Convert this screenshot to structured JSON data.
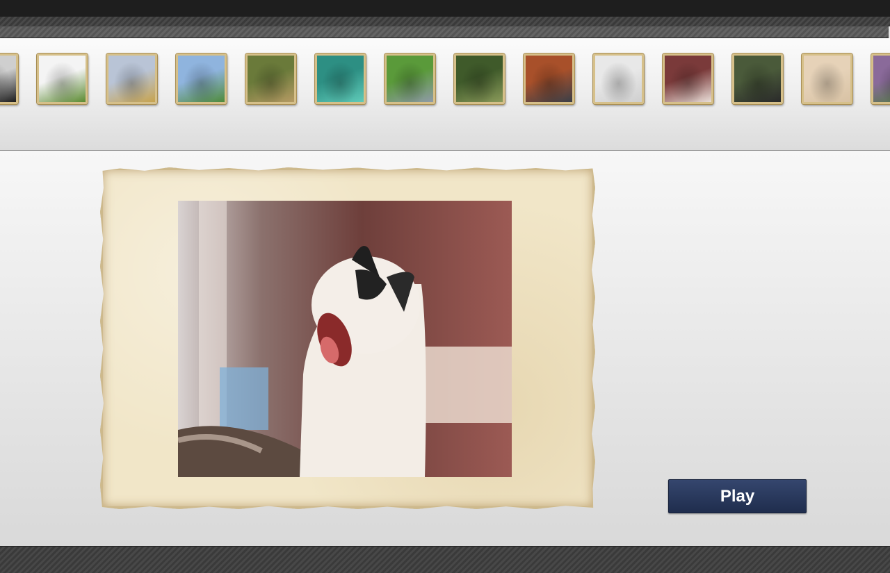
{
  "thumbnails": [
    {
      "icon": "dog-thumbnail-icon",
      "colors": [
        "#cfcfcf",
        "#1c1c1c"
      ]
    },
    {
      "icon": "donkey-thumbnail-icon",
      "colors": [
        "#f4f4f4",
        "#5a8a30"
      ]
    },
    {
      "icon": "giraffe-thumbnail-icon",
      "colors": [
        "#b9c4d6",
        "#c7a34e"
      ]
    },
    {
      "icon": "deer-thumbnail-icon",
      "colors": [
        "#8fb4de",
        "#4e8a3a"
      ]
    },
    {
      "icon": "duckling-thumbnail-icon",
      "colors": [
        "#6a7a3a",
        "#b59a63"
      ]
    },
    {
      "icon": "polar-bear-thumbnail-icon",
      "colors": [
        "#2d8f83",
        "#5fcab8"
      ]
    },
    {
      "icon": "snail-thumbnail-icon",
      "colors": [
        "#5a9a3a",
        "#8f9aa8"
      ]
    },
    {
      "icon": "stork-thumbnail-icon",
      "colors": [
        "#3f5a2a",
        "#8a9a5a"
      ]
    },
    {
      "icon": "wolf-thumbnail-icon",
      "colors": [
        "#a8502a",
        "#3a3f48"
      ]
    },
    {
      "icon": "white-cat-thumbnail-icon",
      "colors": [
        "#e8e8e8",
        "#cfcfcf"
      ]
    },
    {
      "icon": "kitten-thumbnail-icon",
      "colors": [
        "#7a3a3a",
        "#e9ded8"
      ]
    },
    {
      "icon": "monkey-thumbnail-icon",
      "colors": [
        "#4a5a3a",
        "#2a2a2a"
      ]
    },
    {
      "icon": "bird-thumbnail-icon",
      "colors": [
        "#e6d2b8",
        "#d8c2a4"
      ]
    },
    {
      "icon": "flower-thumbnail-icon",
      "colors": [
        "#8a6a9a",
        "#4a7a3a"
      ]
    }
  ],
  "main": {
    "image_icon": "yawning-kitten-photo"
  },
  "controls": {
    "play_label": "Play"
  }
}
